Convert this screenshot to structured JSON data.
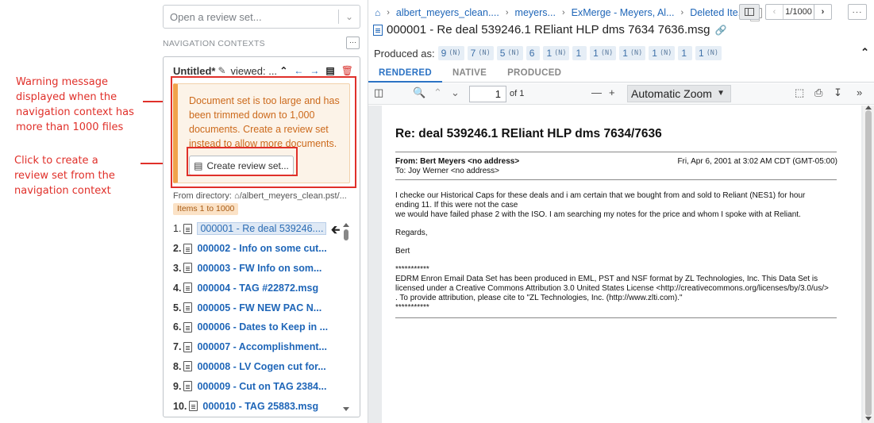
{
  "annotations": {
    "warning_note": [
      "Warning message",
      "displayed when the",
      "navigation context has",
      "more than 1000 files"
    ],
    "create_note": [
      "Click to create a",
      "review set from the",
      "navigation context"
    ]
  },
  "left": {
    "review_select_placeholder": "Open a review set...",
    "nav_contexts_title": "NAVIGATION CONTEXTS",
    "more_label": "···",
    "context": {
      "name": "Untitled*",
      "viewed_label": "viewed: ...",
      "warning_text": "Document set is too large and has been trimmed down to 1,000 documents. Create a review set instead to allow more documents.",
      "create_button_label": "Create review set...",
      "from_directory_label": "From directory:",
      "from_directory_path": "/albert_meyers_clean.pst/...",
      "items_badge": "Items 1 to 1000"
    },
    "documents": [
      {
        "num": "1.",
        "title": "000001 - Re  deal 539246...."
      },
      {
        "num": "2.",
        "title": "000002 - Info on some cut..."
      },
      {
        "num": "3.",
        "title": "000003 - FW  Info on som..."
      },
      {
        "num": "4.",
        "title": "000004 - TAG #22872.msg"
      },
      {
        "num": "5.",
        "title": "000005 - FW  NEW PAC N..."
      },
      {
        "num": "6.",
        "title": "000006 - Dates to Keep in ..."
      },
      {
        "num": "7.",
        "title": "000007 - Accomplishment..."
      },
      {
        "num": "8.",
        "title": "000008 - LV Cogen cut for..."
      },
      {
        "num": "9.",
        "title": "000009 - Cut on TAG 2384..."
      },
      {
        "num": "10.",
        "title": "000010 - TAG 25883.msg"
      }
    ]
  },
  "right": {
    "breadcrumbs": [
      "albert_meyers_clean....",
      "meyers...",
      "ExMerge - Meyers, Al...",
      "Deleted Ite..."
    ],
    "pager_count": "1/1000",
    "more_label": "···",
    "doc_title": "000001 - Re  deal 539246.1 REliant HLP dms 7634 7636.msg",
    "produced_label": "Produced as:",
    "produced_chips": [
      {
        "num": "9",
        "tag": "(N)"
      },
      {
        "num": "7",
        "tag": "(N)"
      },
      {
        "num": "5",
        "tag": "(N)"
      },
      {
        "num": "6",
        "tag": ""
      },
      {
        "num": "1",
        "tag": "(N)"
      },
      {
        "num": "1",
        "tag": ""
      },
      {
        "num": "1",
        "tag": "(N)"
      },
      {
        "num": "1",
        "tag": "(N)"
      },
      {
        "num": "1",
        "tag": "(N)"
      },
      {
        "num": "1",
        "tag": ""
      },
      {
        "num": "1",
        "tag": "(N)"
      }
    ],
    "tabs": [
      "RENDERED",
      "NATIVE",
      "PRODUCED"
    ],
    "page_number": "1",
    "page_of": "of 1",
    "zoom_label": "Automatic Zoom",
    "email": {
      "subject": "Re: deal 539246.1 REliant HLP dms 7634/7636",
      "from": "From: Bert Meyers <no address>",
      "date": "Fri, Apr 6, 2001 at 3:02 AM CDT (GMT-05:00)",
      "to": "To: Joy Werner <no address>",
      "body_1a": "I checke our Historical Caps for these deals and i am certain that we bought from and sold to Reliant (NES1) for hour",
      "body_1b": "ending 11.  If this were not the case",
      "body_1c": "we would have failed phase 2 with the ISO.  I am searching my notes for the price and whom I spoke with at Reliant.",
      "regards": "Regards,",
      "signature": "Bert",
      "stars_1": "***********",
      "footer_a": "EDRM Enron Email Data Set has been produced in EML, PST and NSF format by ZL Technologies, Inc. This Data Set is",
      "footer_b": "licensed under a Creative Commons Attribution 3.0 United States License <http://creativecommons.org/licenses/by/3.0/us/>",
      "footer_c": ". To provide attribution, please cite to \"ZL Technologies, Inc. (http://www.zlti.com).\"",
      "stars_2": "***********"
    }
  },
  "colors": {
    "annotation_red": "#e0302a",
    "link_blue": "#1f66b8",
    "warning_orange": "#f0a34b",
    "warning_text": "#cc6a1c"
  }
}
